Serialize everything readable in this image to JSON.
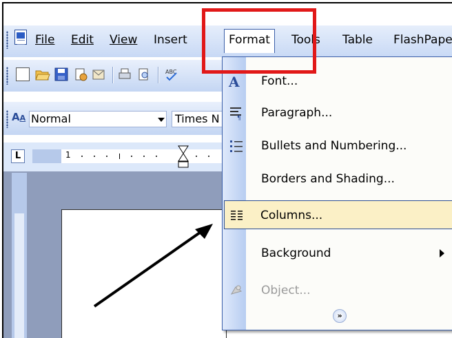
{
  "menubar": {
    "items": [
      {
        "label": "File",
        "key": "F"
      },
      {
        "label": "Edit",
        "key": "E"
      },
      {
        "label": "View",
        "key": "V"
      },
      {
        "label": "Insert",
        "key": "s"
      },
      {
        "label": "Format",
        "key": "o"
      },
      {
        "label": "Tools",
        "key": "o"
      },
      {
        "label": "Table",
        "key": "a"
      },
      {
        "label": "FlashPaper",
        "key": ""
      }
    ]
  },
  "formatting": {
    "style_value": "Normal",
    "font_value": "Times N"
  },
  "ruler": {
    "tab_selector": "L",
    "start_mark": "1"
  },
  "format_menu": {
    "items": [
      {
        "label": "Font...",
        "icon": "font-icon",
        "state": "normal"
      },
      {
        "label": "Paragraph...",
        "icon": "paragraph-icon",
        "state": "normal"
      },
      {
        "label": "Bullets and Numbering...",
        "icon": "bullets-icon",
        "state": "normal"
      },
      {
        "label": "Borders and Shading...",
        "icon": "",
        "state": "normal"
      },
      {
        "label": "Columns...",
        "icon": "columns-icon",
        "state": "highlighted"
      },
      {
        "label": "Background",
        "icon": "",
        "state": "submenu"
      },
      {
        "label": "Object...",
        "icon": "object-icon",
        "state": "disabled"
      }
    ],
    "expand_glyph": "»"
  },
  "colors": {
    "highlight_box": "#e11818",
    "menu_highlight": "#fbf0c6",
    "menu_border": "#3a5ea8",
    "toolbar": "#c8d9f5"
  }
}
